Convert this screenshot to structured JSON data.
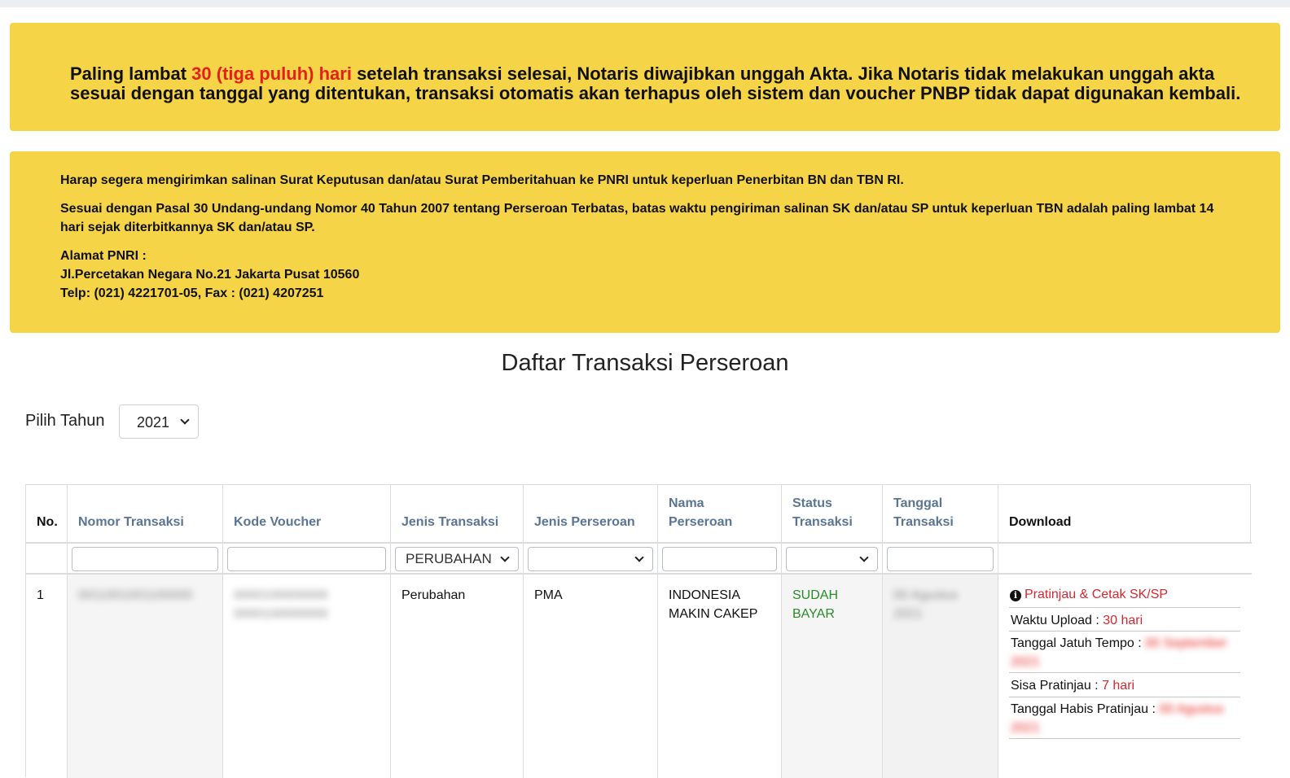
{
  "alert_deadline": {
    "prefix": "Paling lambat ",
    "highlight": "30 (tiga puluh) hari",
    "suffix": " setelah transaksi selesai, Notaris diwajibkan unggah Akta. Jika Notaris tidak melakukan unggah akta sesuai dengan tanggal yang ditentukan, transaksi otomatis akan terhapus oleh sistem dan voucher PNBP tidak dapat digunakan kembali."
  },
  "alert_pnri": {
    "line1": "Harap segera mengirimkan salinan Surat Keputusan dan/atau Surat Pemberitahuan ke PNRI untuk keperluan Penerbitan BN dan TBN RI.",
    "line2": "Sesuai dengan Pasal 30 Undang-undang Nomor 40 Tahun 2007 tentang Perseroan Terbatas, batas waktu pengiriman salinan SK dan/atau SP untuk keperluan TBN adalah paling lambat 14 hari sejak diterbitkannya SK dan/atau SP.",
    "address_label": "Alamat PNRI :",
    "address": "Jl.Percetakan Negara No.21 Jakarta Pusat 10560",
    "phone": "Telp: (021) 4221701-05, Fax : (021) 4207251"
  },
  "page_title": "Daftar Transaksi Perseroan",
  "year_filter": {
    "label": "Pilih Tahun",
    "selected": "2021"
  },
  "table": {
    "headers": {
      "no": "No.",
      "nomor_transaksi": "Nomor Transaksi",
      "kode_voucher": "Kode Voucher",
      "jenis_transaksi": "Jenis Transaksi",
      "jenis_perseroan": "Jenis Perseroan",
      "nama_perseroan": "Nama Perseroan",
      "status_transaksi": "Status Transaksi",
      "tanggal_transaksi": "Tanggal Transaksi",
      "download": "Download"
    },
    "filters": {
      "jenis_transaksi_selected": "PERUBAHAN"
    },
    "rows": [
      {
        "no": "1",
        "nomor_transaksi": "0011001001100000",
        "kode_voucher": "0000100000000 0000100000000",
        "jenis_transaksi": "Perubahan",
        "jenis_perseroan": "PMA",
        "nama_perseroan": "INDONESIA MAKIN CAKEP",
        "status_transaksi": "SUDAH BAYAR",
        "tanggal_transaksi": "00 Agustus 2021",
        "download": {
          "link_label": "Pratinjau & Cetak SK/SP",
          "waktu_upload_label": "Waktu Upload : ",
          "waktu_upload_value": "30 hari",
          "jatuh_tempo_label": "Tanggal Jatuh Tempo : ",
          "jatuh_tempo_value": "00 September 2021",
          "sisa_pratinjau_label": "Sisa Pratinjau : ",
          "sisa_pratinjau_value": "7 hari",
          "habis_pratinjau_label": "Tanggal Habis Pratinjau : ",
          "habis_pratinjau_value": "00 Agustus 2021"
        }
      }
    ]
  },
  "colors": {
    "alert_bg": "#f6d447",
    "highlight_red": "#e5201c",
    "header_link": "#5a7594",
    "status_green": "#2a8a2a"
  }
}
